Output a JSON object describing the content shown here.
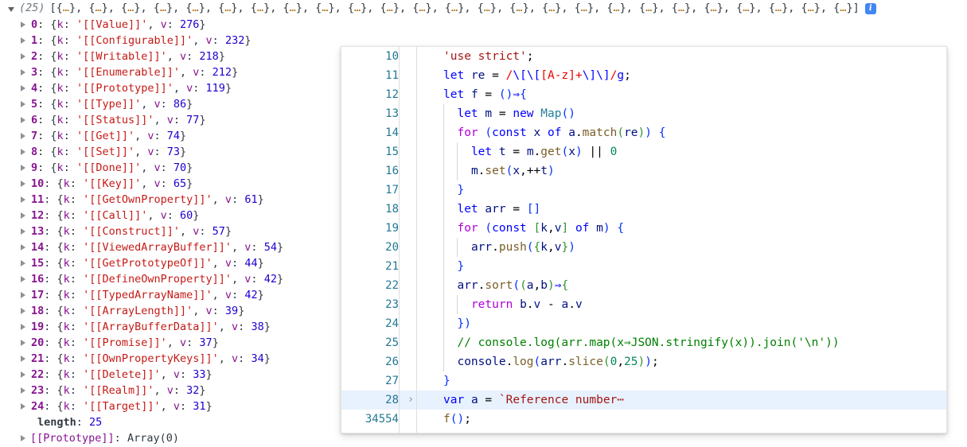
{
  "console": {
    "header": {
      "expander_icon": "triangle-down-icon",
      "count": "(25)",
      "open_bracket": "[",
      "close_bracket": "]",
      "object_stub": "{…}",
      "separator": ", ",
      "stub_count": 25,
      "info_icon_label": "i"
    },
    "entries": [
      {
        "index": "0",
        "key": "'[[Value]]'",
        "value": "276"
      },
      {
        "index": "1",
        "key": "'[[Configurable]]'",
        "value": "232"
      },
      {
        "index": "2",
        "key": "'[[Writable]]'",
        "value": "218"
      },
      {
        "index": "3",
        "key": "'[[Enumerable]]'",
        "value": "212"
      },
      {
        "index": "4",
        "key": "'[[Prototype]]'",
        "value": "119"
      },
      {
        "index": "5",
        "key": "'[[Type]]'",
        "value": "86"
      },
      {
        "index": "6",
        "key": "'[[Status]]'",
        "value": "77"
      },
      {
        "index": "7",
        "key": "'[[Get]]'",
        "value": "74"
      },
      {
        "index": "8",
        "key": "'[[Set]]'",
        "value": "73"
      },
      {
        "index": "9",
        "key": "'[[Done]]'",
        "value": "70"
      },
      {
        "index": "10",
        "key": "'[[Key]]'",
        "value": "65"
      },
      {
        "index": "11",
        "key": "'[[GetOwnProperty]]'",
        "value": "61"
      },
      {
        "index": "12",
        "key": "'[[Call]]'",
        "value": "60"
      },
      {
        "index": "13",
        "key": "'[[Construct]]'",
        "value": "57"
      },
      {
        "index": "14",
        "key": "'[[ViewedArrayBuffer]]'",
        "value": "54"
      },
      {
        "index": "15",
        "key": "'[[GetPrototypeOf]]'",
        "value": "44"
      },
      {
        "index": "16",
        "key": "'[[DefineOwnProperty]]'",
        "value": "42"
      },
      {
        "index": "17",
        "key": "'[[TypedArrayName]]'",
        "value": "42"
      },
      {
        "index": "18",
        "key": "'[[ArrayLength]]'",
        "value": "39"
      },
      {
        "index": "19",
        "key": "'[[ArrayBufferData]]'",
        "value": "38"
      },
      {
        "index": "20",
        "key": "'[[Promise]]'",
        "value": "37"
      },
      {
        "index": "21",
        "key": "'[[OwnPropertyKeys]]'",
        "value": "34"
      },
      {
        "index": "22",
        "key": "'[[Delete]]'",
        "value": "33"
      },
      {
        "index": "23",
        "key": "'[[Realm]]'",
        "value": "32"
      },
      {
        "index": "24",
        "key": "'[[Target]]'",
        "value": "31"
      }
    ],
    "entry_prefix": "{k: ",
    "entry_middle": ", v: ",
    "entry_suffix": "}",
    "length_label": "length",
    "length_value": "25",
    "prototype_label": "[[Prototype]]",
    "prototype_value": "Array(0)"
  },
  "editor": {
    "active_line": "28",
    "lines": [
      {
        "num": "10",
        "fold": "",
        "text": "'use strict';"
      },
      {
        "num": "11",
        "fold": "",
        "text": "let re = /\\[\\[[A-z]+\\]\\]/g;"
      },
      {
        "num": "12",
        "fold": "",
        "text": "let f = ()⇒{"
      },
      {
        "num": "13",
        "fold": "",
        "text": "  let m = new Map()"
      },
      {
        "num": "14",
        "fold": "",
        "text": "  for (const x of a.match(re)) {"
      },
      {
        "num": "15",
        "fold": "",
        "text": "    let t = m.get(x) || 0"
      },
      {
        "num": "16",
        "fold": "",
        "text": "    m.set(x,++t)"
      },
      {
        "num": "17",
        "fold": "",
        "text": "  }"
      },
      {
        "num": "18",
        "fold": "",
        "text": "  let arr = []"
      },
      {
        "num": "19",
        "fold": "",
        "text": "  for (const [k,v] of m) {"
      },
      {
        "num": "20",
        "fold": "",
        "text": "    arr.push({k,v})"
      },
      {
        "num": "21",
        "fold": "",
        "text": "  }"
      },
      {
        "num": "22",
        "fold": "",
        "text": "  arr.sort((a,b)⇒{"
      },
      {
        "num": "23",
        "fold": "",
        "text": "    return b.v - a.v"
      },
      {
        "num": "24",
        "fold": "",
        "text": "  })"
      },
      {
        "num": "25",
        "fold": "",
        "text": "  // console.log(arr.map(x⇒JSON.stringify(x)).join('\\n'))"
      },
      {
        "num": "26",
        "fold": "",
        "text": "  console.log(arr.slice(0,25));"
      },
      {
        "num": "27",
        "fold": "",
        "text": "}"
      },
      {
        "num": "28",
        "fold": "›",
        "text": "var a = `Reference number⋯"
      },
      {
        "num": "34554",
        "fold": "",
        "text": "f();"
      }
    ]
  },
  "colors": {
    "accent_blue": "#4285f4",
    "gutter": "#237893",
    "active_line_bg": "#e8f2fe",
    "keyword": "#0000ff",
    "keyword_control": "#af00db",
    "string": "#a31515",
    "number": "#098658",
    "function": "#795e26",
    "variable": "#001080",
    "class": "#267f99",
    "comment": "#008000",
    "console_key": "#881391",
    "console_string": "#c41a16",
    "console_number": "#1c00cf"
  }
}
